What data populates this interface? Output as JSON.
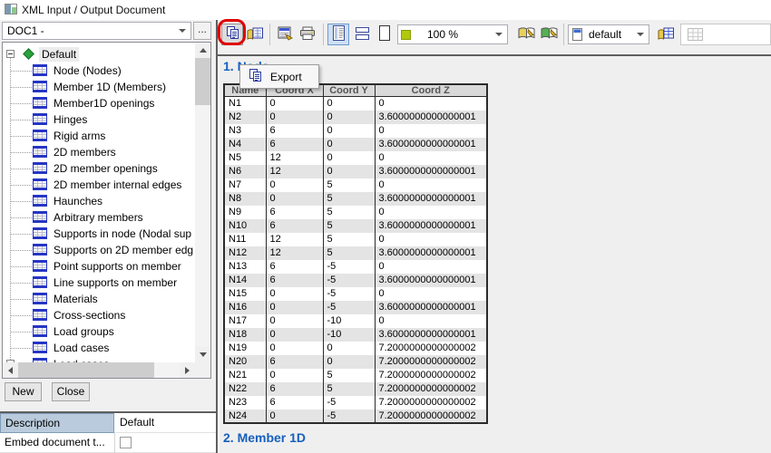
{
  "window": {
    "title": "XML Input / Output Document"
  },
  "left_panel": {
    "doc_combo": {
      "value": "DOC1 -",
      "more_button": "..."
    },
    "tree": {
      "root": "Default",
      "items": [
        "Node (Nodes)",
        "Member 1D (Members)",
        "Member1D openings",
        "Hinges",
        "Rigid arms",
        "2D members",
        "2D member openings",
        "2D member internal edges",
        "Haunches",
        "Arbitrary members",
        "Supports in node (Nodal sup",
        "Supports on 2D member edg",
        "Point supports on member",
        "Line supports on member",
        "Materials",
        "Cross-sections",
        "Load groups",
        "Load cases",
        "Load cases"
      ]
    },
    "buttons": {
      "new": "New",
      "close": "Close"
    },
    "properties": [
      {
        "label": "Description",
        "value": "Default",
        "type": "text"
      },
      {
        "label": "Embed document t...",
        "value": false,
        "type": "checkbox"
      }
    ]
  },
  "toolbar": {
    "tooltip": "Export",
    "zoom_value": "100 %",
    "style_value": "default"
  },
  "document": {
    "section1_title": "1. Node",
    "section2_title": "2. Member 1D",
    "table": {
      "columns": [
        "Name",
        "Coord X",
        "Coord Y",
        "Coord Z"
      ],
      "rows": [
        [
          "N1",
          "0",
          "0",
          "0"
        ],
        [
          "N2",
          "0",
          "0",
          "3.6000000000000001"
        ],
        [
          "N3",
          "6",
          "0",
          "0"
        ],
        [
          "N4",
          "6",
          "0",
          "3.6000000000000001"
        ],
        [
          "N5",
          "12",
          "0",
          "0"
        ],
        [
          "N6",
          "12",
          "0",
          "3.6000000000000001"
        ],
        [
          "N7",
          "0",
          "5",
          "0"
        ],
        [
          "N8",
          "0",
          "5",
          "3.6000000000000001"
        ],
        [
          "N9",
          "6",
          "5",
          "0"
        ],
        [
          "N10",
          "6",
          "5",
          "3.6000000000000001"
        ],
        [
          "N11",
          "12",
          "5",
          "0"
        ],
        [
          "N12",
          "12",
          "5",
          "3.6000000000000001"
        ],
        [
          "N13",
          "6",
          "-5",
          "0"
        ],
        [
          "N14",
          "6",
          "-5",
          "3.6000000000000001"
        ],
        [
          "N15",
          "0",
          "-5",
          "0"
        ],
        [
          "N16",
          "0",
          "-5",
          "3.6000000000000001"
        ],
        [
          "N17",
          "0",
          "-10",
          "0"
        ],
        [
          "N18",
          "0",
          "-10",
          "3.6000000000000001"
        ],
        [
          "N19",
          "0",
          "0",
          "7.2000000000000002"
        ],
        [
          "N20",
          "6",
          "0",
          "7.2000000000000002"
        ],
        [
          "N21",
          "0",
          "5",
          "7.2000000000000002"
        ],
        [
          "N22",
          "6",
          "5",
          "7.2000000000000002"
        ],
        [
          "N23",
          "6",
          "-5",
          "7.2000000000000002"
        ],
        [
          "N24",
          "0",
          "-5",
          "7.2000000000000002"
        ]
      ]
    }
  },
  "colors": {
    "heading_blue": "#1560bd",
    "annotation_red": "#e00000",
    "zoom_swatch_green": "#b2c80e",
    "tree_icon_blue": "#2635c4",
    "selected_property_bg": "#b9cbdc"
  }
}
